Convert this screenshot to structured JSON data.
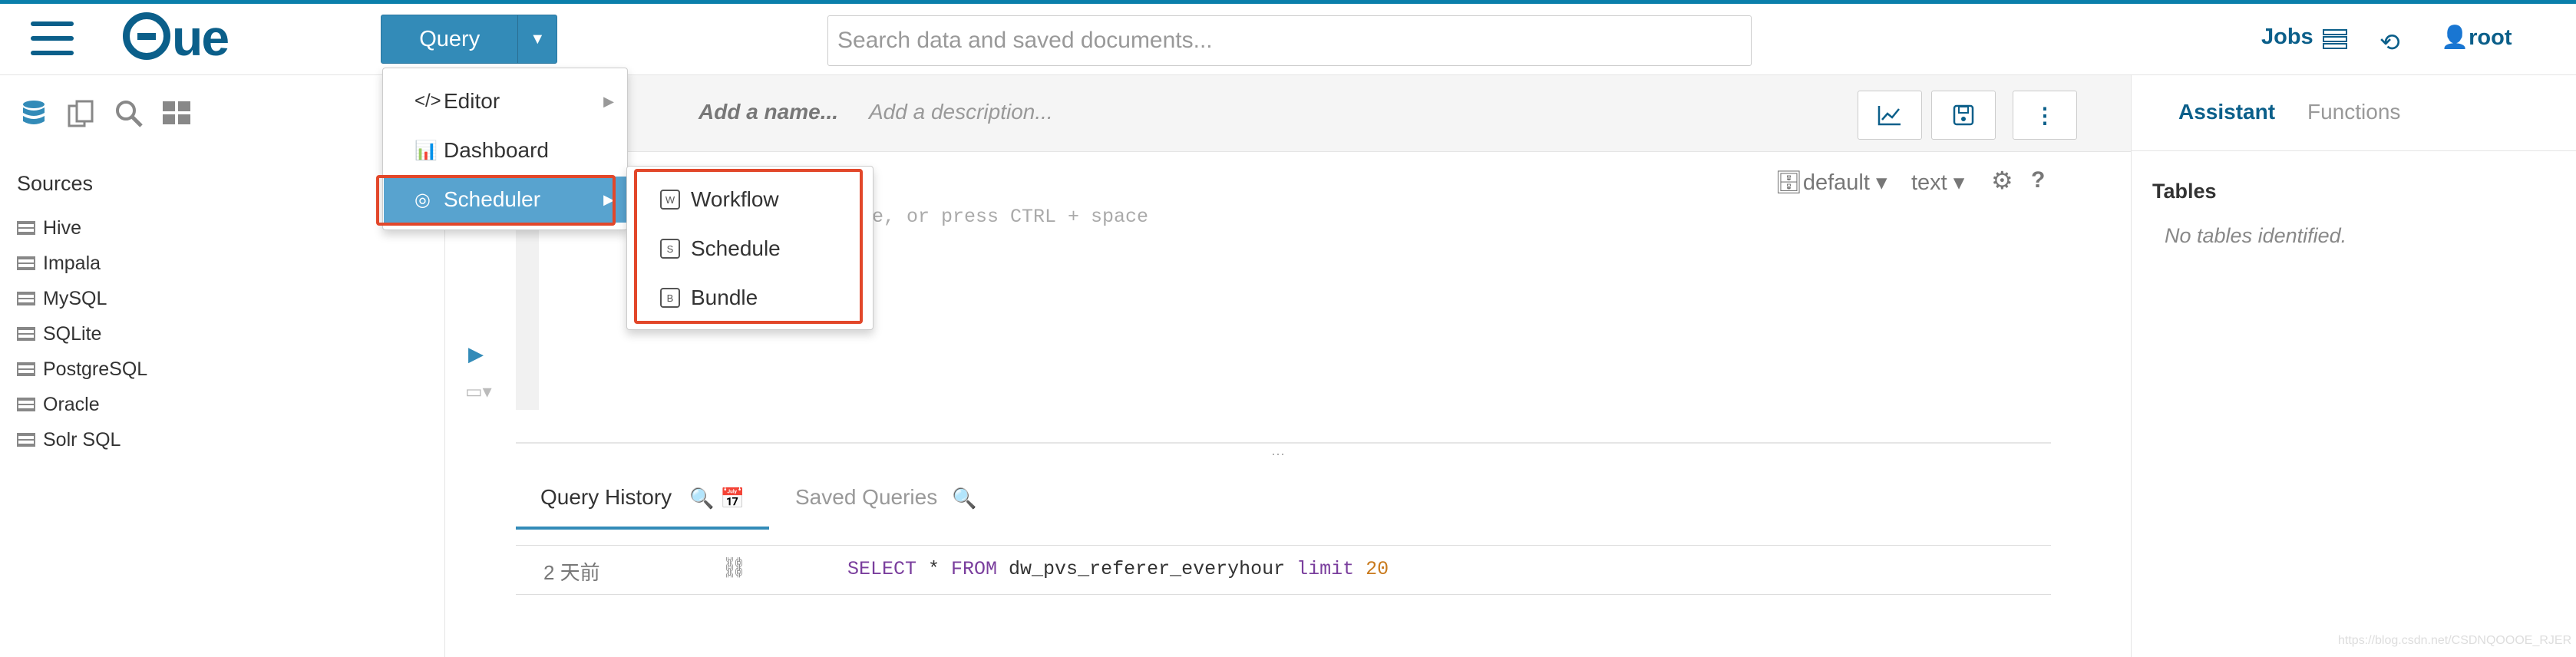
{
  "header": {
    "logo_text": "HUE",
    "query_button": "Query",
    "search_placeholder": "Search data and saved documents...",
    "jobs_label": "Jobs",
    "user_label": "root"
  },
  "query_menu": {
    "items": [
      {
        "label": "Editor",
        "icon": "code-icon"
      },
      {
        "label": "Dashboard",
        "icon": "dashboard-icon"
      },
      {
        "label": "Scheduler",
        "icon": "scheduler-icon",
        "active": true
      }
    ],
    "scheduler_submenu": [
      {
        "label": "Workflow",
        "icon": "workflow-icon"
      },
      {
        "label": "Schedule",
        "icon": "schedule-icon"
      },
      {
        "label": "Bundle",
        "icon": "bundle-icon"
      }
    ]
  },
  "left_panel": {
    "sources_title": "Sources",
    "sources": [
      "Hive",
      "Impala",
      "MySQL",
      "SQLite",
      "PostgreSQL",
      "Oracle",
      "Solr SQL"
    ]
  },
  "editor": {
    "name_placeholder": "Add a name...",
    "description_placeholder": "Add a description...",
    "editor_placeholder": "ame, or press CTRL + space",
    "database": "default",
    "type": "text"
  },
  "bottom_tabs": {
    "query_history": "Query History",
    "saved_queries": "Saved Queries"
  },
  "history_rows": [
    {
      "time": "2 天前",
      "sql_select": "SELECT",
      "sql_star": " * ",
      "sql_from": "FROM",
      "sql_table": " dw_pvs_referer_everyhour ",
      "sql_limit": "limit",
      "sql_num": " 20"
    }
  ],
  "right_panel": {
    "assistant_tab": "Assistant",
    "functions_tab": "Functions",
    "tables_title": "Tables",
    "no_tables": "No tables identified."
  },
  "watermark": "https://blog.csdn.net/CSDNQOOOE_RJER",
  "colors": {
    "accent": "#338bb8",
    "brand": "#0b5f8a",
    "highlight_border": "#e2472a",
    "menu_active": "#58a3cf"
  }
}
